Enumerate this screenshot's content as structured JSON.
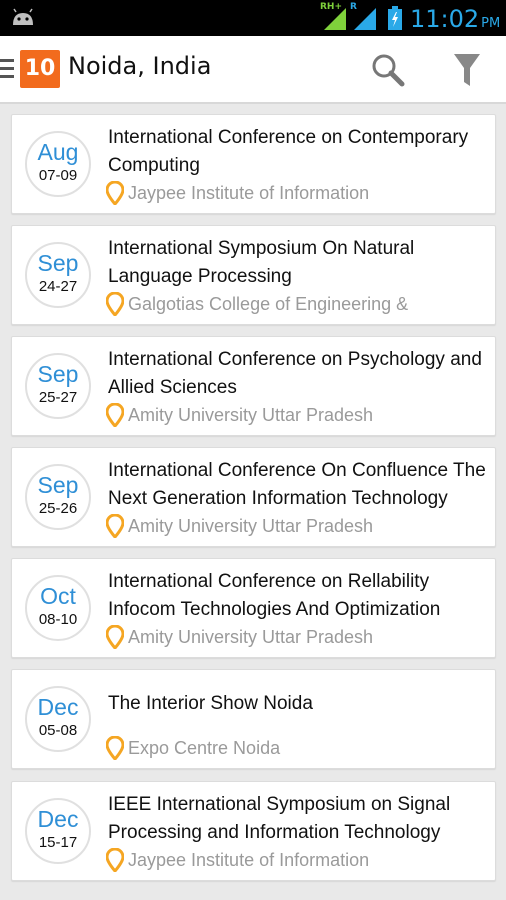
{
  "status_bar": {
    "time": "11:02",
    "ampm": "PM",
    "network_label_1": "RH+",
    "network_label_2": "R",
    "icons": [
      "android-icon",
      "signal-icon",
      "signal-icon",
      "battery-charging-icon"
    ]
  },
  "app_bar": {
    "logo_text": "10",
    "city": "Noida, India",
    "icons": [
      "menu-icon",
      "search-icon",
      "filter-icon"
    ]
  },
  "colors": {
    "accent_orange": "#f26b1d",
    "month_blue": "#2f8fd6",
    "pin_orange": "#f5a623",
    "clock_blue": "#2aa9e8"
  },
  "events": [
    {
      "month": "Aug",
      "days": "07-09",
      "title": "International Conference on  Contemporary Computing",
      "venue": "Jaypee Institute of Information"
    },
    {
      "month": "Sep",
      "days": "24-27",
      "title": "International Symposium On Natural Language Processing",
      "venue": "Galgotias College of Engineering &"
    },
    {
      "month": "Sep",
      "days": "25-27",
      "title": "International Conference on Psychology and Allied Sciences",
      "venue": "Amity University Uttar Pradesh"
    },
    {
      "month": "Sep",
      "days": "25-26",
      "title": "International Conference On Confluence The Next Generation Information Technology",
      "venue": "Amity University Uttar Pradesh"
    },
    {
      "month": "Oct",
      "days": "08-10",
      "title": "International Conference on Rellability Infocom Technologies And Optimization",
      "venue": "Amity University Uttar Pradesh"
    },
    {
      "month": "Dec",
      "days": "05-08",
      "title": "The Interior Show Noida",
      "venue": "Expo Centre Noida"
    },
    {
      "month": "Dec",
      "days": "15-17",
      "title": "IEEE International Symposium on Signal Processing and Information Technology",
      "venue": "Jaypee Institute of Information"
    }
  ]
}
